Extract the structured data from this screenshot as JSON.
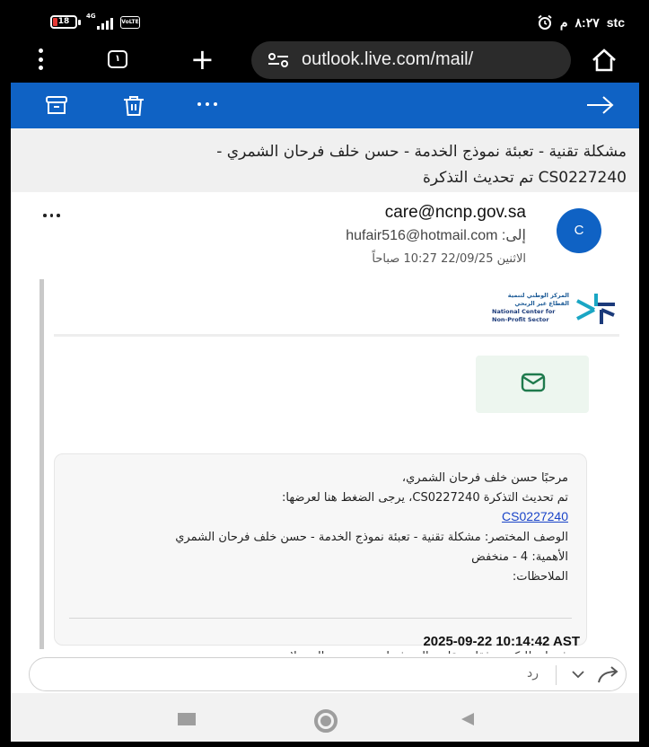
{
  "status_bar": {
    "battery_level": "18",
    "network": "4G",
    "volte": "VoLTE",
    "time": "٨:٢٧",
    "am_pm": "م",
    "carrier": "stc"
  },
  "browser": {
    "tab_count": "١",
    "url": "outlook.live.com/mail/"
  },
  "mail_toolbar": {
    "icons": [
      "archive-icon",
      "trash-icon",
      "more-icon",
      "arrow-right-icon"
    ]
  },
  "email": {
    "subject_line1": "مشكلة تقنية - تعبئة نموذج الخدمة - حسن خلف فرحان الشمري -",
    "subject_line2": "CS0227240 تم تحديث التذكرة",
    "sender_initial": "C",
    "from": "care@ncnp.gov.sa",
    "to_label": "إلى:",
    "to_address": "hufair516@hotmail.com",
    "date": "الاثنين 22/09/25 10:27 صباحاً"
  },
  "logo": {
    "arabic_line1": "المركز الوطني لتنمية",
    "arabic_line2": "القطاع غير الربحي",
    "english_line1": "National Center for",
    "english_line2": "Non-Profit Sector"
  },
  "ticket": {
    "greeting": "مرحبًا حسن خلف فرحان الشمري،",
    "update_text": "تم تحديث التذكرة CS0227240، يرجى الضغط هنا لعرضها:",
    "link_text": "CS0227240",
    "short_desc": "الوصف المختصر: مشكلة تقنية - تعبئة نموذج الخدمة - حسن خلف فرحان الشمري",
    "priority": "الأهمية: 4 - منخفض",
    "notes": "الملاحظات:",
    "timestamp": "2025-09-22 10:14:42 AST",
    "cut_text": "مرفق لـ طلبكم مرفقات تقارير الصرف لتوضيح جميع التحويلات"
  },
  "reply": {
    "label": "رد"
  },
  "colors": {
    "outlook_blue": "#0f62c4",
    "link_blue": "#1a44c8",
    "mail_icon_green": "#1f7a4d"
  }
}
